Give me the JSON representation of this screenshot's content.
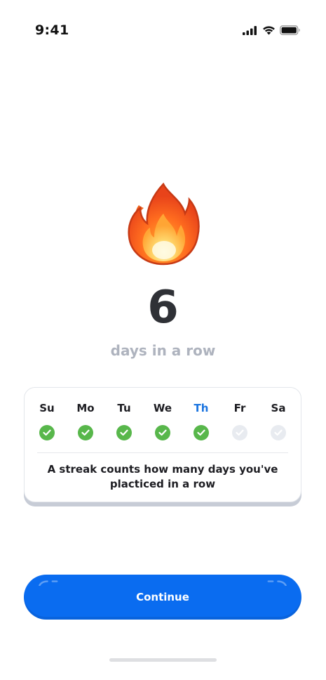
{
  "status_bar": {
    "time": "9:41",
    "icons": [
      "cellular-signal-icon",
      "wifi-icon",
      "battery-icon"
    ]
  },
  "hero": {
    "icon": "fire-icon",
    "streak_count": "6",
    "caption": "days in a row"
  },
  "week": {
    "days": [
      {
        "label": "Su",
        "status": "done",
        "today": false
      },
      {
        "label": "Mo",
        "status": "done",
        "today": false
      },
      {
        "label": "Tu",
        "status": "done",
        "today": false
      },
      {
        "label": "We",
        "status": "done",
        "today": false
      },
      {
        "label": "Th",
        "status": "done",
        "today": true
      },
      {
        "label": "Fr",
        "status": "pending",
        "today": false
      },
      {
        "label": "Sa",
        "status": "pending",
        "today": false
      }
    ],
    "note": "A streak counts how many days you've placticed in a row"
  },
  "actions": {
    "continue_label": "Continue"
  },
  "colors": {
    "accent": "#0a6cf0",
    "today_label": "#1a74e0",
    "done_check": "#58b74b",
    "pending_check": "#e8ebf0",
    "caption": "#aeb3be"
  }
}
